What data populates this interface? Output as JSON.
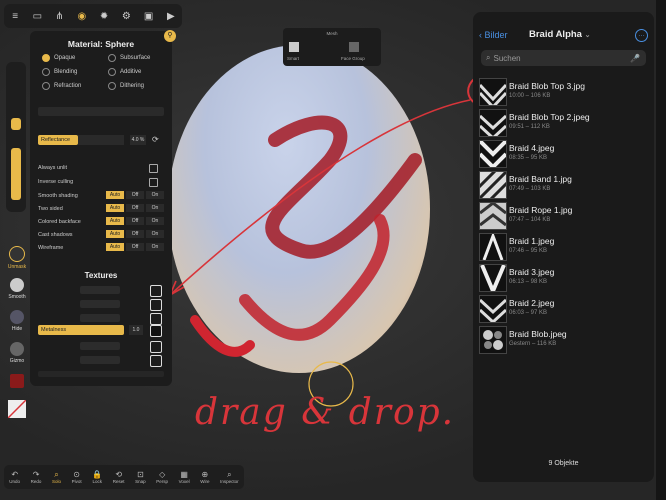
{
  "toolbar": {
    "icons": [
      "menu-icon",
      "folder-icon",
      "share-icon",
      "camera-icon",
      "sun-icon",
      "gear-icon",
      "image-icon",
      "video-icon"
    ]
  },
  "material": {
    "title": "Material:  Sphere",
    "modes": [
      {
        "label": "Opaque",
        "on": true
      },
      {
        "label": "Subsurface",
        "on": false
      },
      {
        "label": "Blending",
        "on": false
      },
      {
        "label": "Additive",
        "on": false
      },
      {
        "label": "Refraction",
        "on": false
      },
      {
        "label": "Dithering",
        "on": false
      }
    ],
    "reflectance_label": "Reflectance",
    "reflectance_value": "4.0 %",
    "always_unlit": "Always unlit",
    "inverse_culling": "Inverse culling",
    "rows": [
      {
        "label": "Smooth shading",
        "opts": [
          "Auto",
          "Off",
          "On"
        ]
      },
      {
        "label": "Two sided",
        "opts": [
          "Auto",
          "Off",
          "On"
        ]
      },
      {
        "label": "Colored backface",
        "opts": [
          "Auto",
          "Off",
          "On"
        ]
      },
      {
        "label": "Cast shadows",
        "opts": [
          "Auto",
          "Off",
          "On"
        ]
      },
      {
        "label": "Wireframe",
        "opts": [
          "Auto",
          "Off",
          "On"
        ]
      }
    ],
    "textures_title": "Textures",
    "metalness_label": "Metalness",
    "metalness_value": "1.0"
  },
  "sidetools": [
    {
      "label": "Unmask"
    },
    {
      "label": "Smooth"
    },
    {
      "label": "Hide"
    },
    {
      "label": "Gizmo"
    }
  ],
  "meshpopup": {
    "title": "Mesh",
    "items": [
      "Smart",
      "",
      "",
      "Face Group",
      ""
    ]
  },
  "picker": {
    "back_label": "Bilder",
    "title": "Braid Alpha",
    "search_placeholder": "Suchen",
    "files": [
      {
        "name": "Braid Blob Top 3.jpg",
        "meta": "10:00 – 106 KB"
      },
      {
        "name": "Braid Blob Top 2.jpeg",
        "meta": "09:51 – 112 KB"
      },
      {
        "name": "Braid 4.jpeg",
        "meta": "08:35 – 95 KB"
      },
      {
        "name": "Braid Band 1.jpg",
        "meta": "07:49 – 103 KB"
      },
      {
        "name": "Braid Rope 1.jpg",
        "meta": "07:47 – 104 KB"
      },
      {
        "name": "Braid 1.jpeg",
        "meta": "07:46 – 95 KB"
      },
      {
        "name": "Braid 3.jpeg",
        "meta": "06:13 – 98 KB"
      },
      {
        "name": "Braid 2.jpeg",
        "meta": "06:03 – 97 KB"
      },
      {
        "name": "Braid Blob.jpeg",
        "meta": "Gestern – 116 KB"
      }
    ],
    "count": "9 Objekte"
  },
  "annotation": {
    "text": "drag & drop."
  },
  "bottom": {
    "tools": [
      {
        "label": "Undo",
        "glyph": "↶"
      },
      {
        "label": "Redo",
        "glyph": "↷"
      },
      {
        "label": "Solo",
        "glyph": "⌕"
      },
      {
        "label": "Pivot",
        "glyph": "⊙"
      },
      {
        "label": "Lock",
        "glyph": "🔒"
      },
      {
        "label": "Reset",
        "glyph": "⟲"
      },
      {
        "label": "Snap",
        "glyph": "⊡"
      },
      {
        "label": "Persp",
        "glyph": "◇"
      },
      {
        "label": "Voxel",
        "glyph": "▦"
      },
      {
        "label": "Wire",
        "glyph": "⊕"
      },
      {
        "label": "Inspector",
        "glyph": "⌕"
      }
    ]
  },
  "colors": {
    "accent": "#e8b94a",
    "ios_blue": "#4a90e2",
    "annotation_red": "#d8353a"
  }
}
